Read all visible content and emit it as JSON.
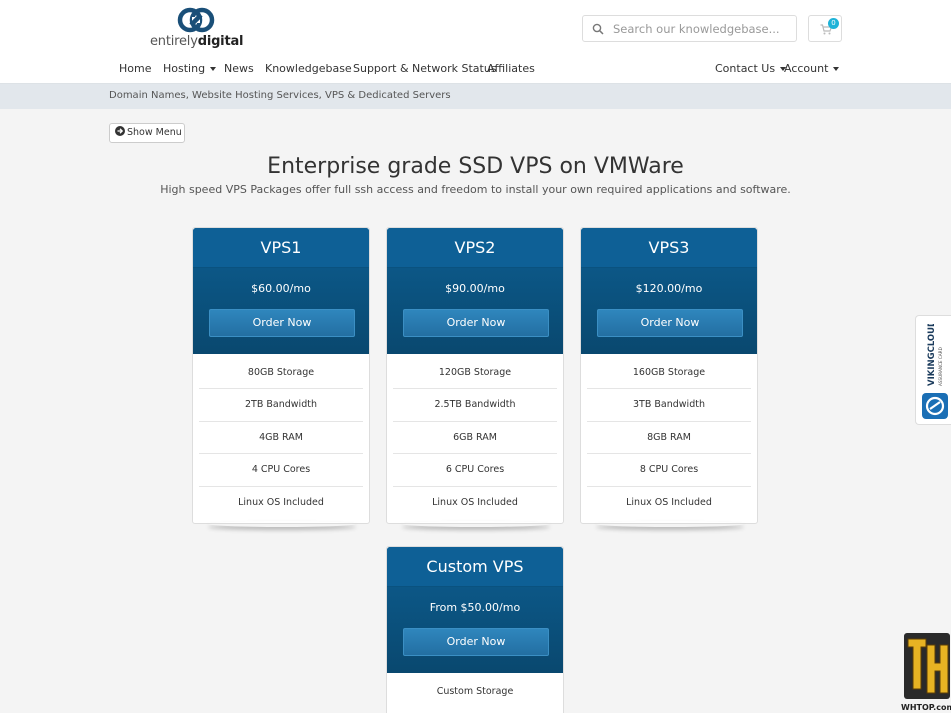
{
  "brand": {
    "word_light": "entirely",
    "word_bold": "digital"
  },
  "search": {
    "placeholder": "Search our knowledgebase..."
  },
  "cart": {
    "count": "0"
  },
  "nav": {
    "home": "Home",
    "hosting": "Hosting",
    "news": "News",
    "knowledgebase": "Knowledgebase",
    "support": "Support & Network Status",
    "affiliates": "Affiliates",
    "contact": "Contact Us",
    "account": "Account"
  },
  "breadcrumb": "Domain Names, Website Hosting Services, VPS & Dedicated Servers",
  "show_menu": "Show Menu",
  "page": {
    "title": "Enterprise grade SSD VPS on VMWare",
    "subtitle": "High speed VPS Packages offer full ssh access and freedom to install your own required applications and software."
  },
  "plans": [
    {
      "name": "VPS1",
      "price": "$60.00/mo",
      "order": "Order Now",
      "features": [
        "80GB Storage",
        "2TB Bandwidth",
        "4GB RAM",
        "4 CPU Cores",
        "Linux OS Included"
      ]
    },
    {
      "name": "VPS2",
      "price": "$90.00/mo",
      "order": "Order Now",
      "features": [
        "120GB Storage",
        "2.5TB Bandwidth",
        "6GB RAM",
        "6 CPU Cores",
        "Linux OS Included"
      ]
    },
    {
      "name": "VPS3",
      "price": "$120.00/mo",
      "order": "Order Now",
      "features": [
        "160GB Storage",
        "3TB Bandwidth",
        "8GB RAM",
        "8 CPU Cores",
        "Linux OS Included"
      ]
    },
    {
      "name": "Custom VPS",
      "price": "From $50.00/mo",
      "order": "Order Now",
      "features": [
        "Custom Storage"
      ]
    }
  ],
  "badge": {
    "viking_line1": "VIKINGCLOUD",
    "viking_line2": "ASSURANCE CARD",
    "watermark": "WHTOP.com"
  },
  "colors": {
    "plan_header": "#0d5e91",
    "order_button": "#2a7db3",
    "cart_badge": "#1fb3d8"
  }
}
